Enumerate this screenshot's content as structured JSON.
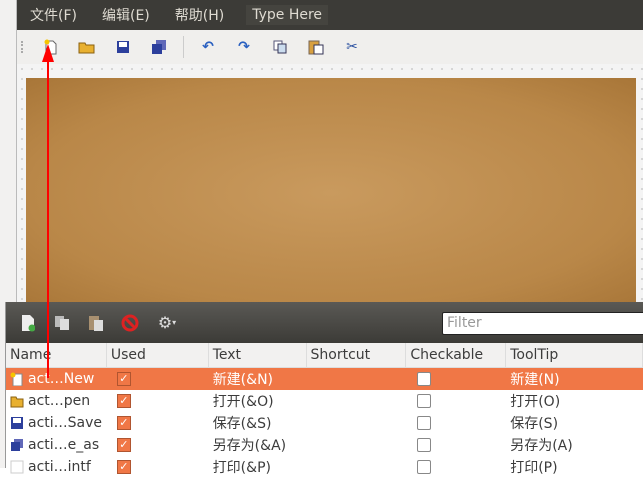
{
  "menubar": {
    "items": [
      "文件(F)",
      "编辑(E)",
      "帮助(H)"
    ],
    "type_here": "Type Here"
  },
  "toolbar": {
    "icons": [
      "new-file-icon",
      "open-folder-icon",
      "save-icon",
      "save-as-icon",
      "undo-icon",
      "redo-icon",
      "copy-icon",
      "paste-icon",
      "cut-icon"
    ]
  },
  "action_editor": {
    "filter_placeholder": "Filter",
    "columns": [
      "Name",
      "Used",
      "Text",
      "Shortcut",
      "Checkable",
      "ToolTip"
    ],
    "rows": [
      {
        "name": "act…New",
        "used": true,
        "text": "新建(&N)",
        "shortcut": "",
        "checkable": false,
        "tooltip": "新建(N)",
        "selected": true
      },
      {
        "name": "act…pen",
        "used": true,
        "text": "打开(&O)",
        "shortcut": "",
        "checkable": false,
        "tooltip": "打开(O)"
      },
      {
        "name": "acti…Save",
        "used": true,
        "text": "保存(&S)",
        "shortcut": "",
        "checkable": false,
        "tooltip": "保存(S)"
      },
      {
        "name": "acti…e_as",
        "used": true,
        "text": "另存为(&A)",
        "shortcut": "",
        "checkable": false,
        "tooltip": "另存为(A)"
      },
      {
        "name": "acti…intf",
        "used": true,
        "text": "打印(&P)",
        "shortcut": "",
        "checkable": false,
        "tooltip": "打印(P)"
      }
    ]
  },
  "colors": {
    "accent": "#f07746",
    "menubar": "#3c3b37",
    "arrow": "#ff0000"
  }
}
